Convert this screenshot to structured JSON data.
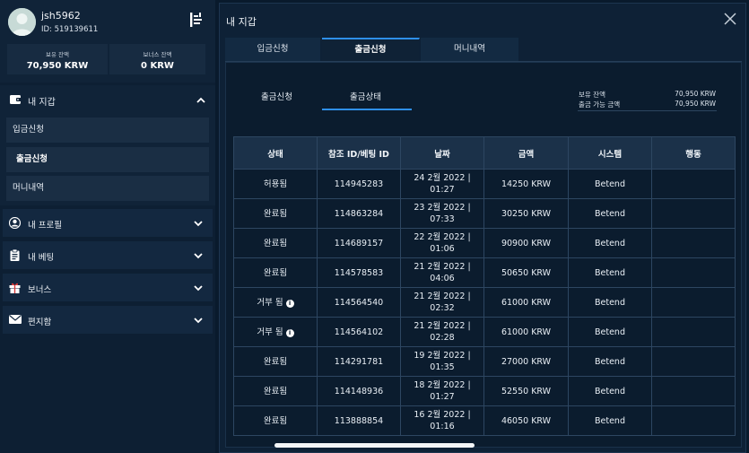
{
  "user": {
    "name": "jsh5962",
    "id_line": "ID: 519139611"
  },
  "balances": [
    {
      "label": "보유 잔액",
      "value": "70,950 KRW"
    },
    {
      "label": "보너스 잔액",
      "value": "0 KRW"
    }
  ],
  "sidebar": {
    "wallet_label": "내 지갑",
    "wallet_items": [
      {
        "label": "입금신청"
      },
      {
        "label": "출금신청"
      },
      {
        "label": "머니내역"
      }
    ],
    "menu": [
      {
        "label": "내 프로필",
        "icon": "user-icon"
      },
      {
        "label": "내 베팅",
        "icon": "clipboard-icon"
      },
      {
        "label": "보너스",
        "icon": "gift-icon"
      },
      {
        "label": "편지함",
        "icon": "mail-icon"
      }
    ]
  },
  "panel": {
    "title": "내 지갑",
    "tabs": [
      {
        "label": "입금신청"
      },
      {
        "label": "출금신청"
      },
      {
        "label": "머니내역"
      }
    ],
    "subtabs": [
      {
        "label": "출금신청"
      },
      {
        "label": "출금상태"
      }
    ],
    "summary": [
      {
        "label": "보유 잔액",
        "value": "70,950 KRW"
      },
      {
        "label": "출금 가능 금액",
        "value": "70,950 KRW"
      }
    ],
    "table": {
      "headers": [
        "상태",
        "참조 ID/베팅 ID",
        "날짜",
        "금액",
        "시스템",
        "행동"
      ],
      "rows": [
        {
          "status": "허용됨",
          "info": false,
          "ref": "114945283",
          "date1": "24 2월 2022 |",
          "date2": "01:27",
          "amount": "14250 KRW",
          "system": "Betend",
          "action": ""
        },
        {
          "status": "완료됨",
          "info": false,
          "ref": "114863284",
          "date1": "23 2월 2022 |",
          "date2": "07:33",
          "amount": "30250 KRW",
          "system": "Betend",
          "action": ""
        },
        {
          "status": "완료됨",
          "info": false,
          "ref": "114689157",
          "date1": "22 2월 2022 |",
          "date2": "01:06",
          "amount": "90900 KRW",
          "system": "Betend",
          "action": ""
        },
        {
          "status": "완료됨",
          "info": false,
          "ref": "114578583",
          "date1": "21 2월 2022 |",
          "date2": "04:06",
          "amount": "50650 KRW",
          "system": "Betend",
          "action": ""
        },
        {
          "status": "거부 됨",
          "info": true,
          "ref": "114564540",
          "date1": "21 2월 2022 |",
          "date2": "02:32",
          "amount": "61000 KRW",
          "system": "Betend",
          "action": ""
        },
        {
          "status": "거부 됨",
          "info": true,
          "ref": "114564102",
          "date1": "21 2월 2022 |",
          "date2": "02:28",
          "amount": "61000 KRW",
          "system": "Betend",
          "action": ""
        },
        {
          "status": "완료됨",
          "info": false,
          "ref": "114291781",
          "date1": "19 2월 2022 |",
          "date2": "01:35",
          "amount": "27000 KRW",
          "system": "Betend",
          "action": ""
        },
        {
          "status": "완료됨",
          "info": false,
          "ref": "114148936",
          "date1": "18 2월 2022 |",
          "date2": "01:27",
          "amount": "52550 KRW",
          "system": "Betend",
          "action": ""
        },
        {
          "status": "완료됨",
          "info": false,
          "ref": "113888854",
          "date1": "16 2월 2022 |",
          "date2": "01:16",
          "amount": "46050 KRW",
          "system": "Betend",
          "action": ""
        }
      ]
    }
  },
  "colors": {
    "accent": "#2e8fe8",
    "background": "#091a2c"
  }
}
